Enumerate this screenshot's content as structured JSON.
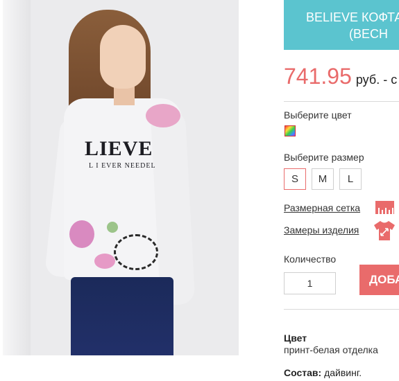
{
  "product": {
    "title_line1": "BELIEVE КОФТА",
    "title_line2": "(ВЕСН",
    "price": "741.95",
    "currency": "руб. - с"
  },
  "color_section": {
    "label": "Выберите цвет"
  },
  "size_section": {
    "label": "Выберите размер",
    "sizes": [
      "S",
      "M",
      "L"
    ],
    "selected": "S"
  },
  "links": {
    "size_chart": "Размерная сетка",
    "measurements": "Замеры изделия"
  },
  "quantity": {
    "label": "Количество",
    "value": "1"
  },
  "add_button": {
    "label": "ДОБА"
  },
  "specs": {
    "color_label": "Цвет",
    "color_value": "принт-белая отделка",
    "composition_label": "Состав:",
    "composition_value": "дайвинг."
  },
  "image_print": {
    "main": "LIEVE",
    "sub": "L I EVER NEEDEL"
  },
  "colors": {
    "accent": "#5bc4cf",
    "price": "#e96b6b",
    "button": "#e96b6b"
  },
  "icons": [
    "color-swatch-icon",
    "ruler-icon",
    "tshirt-measure-icon"
  ]
}
